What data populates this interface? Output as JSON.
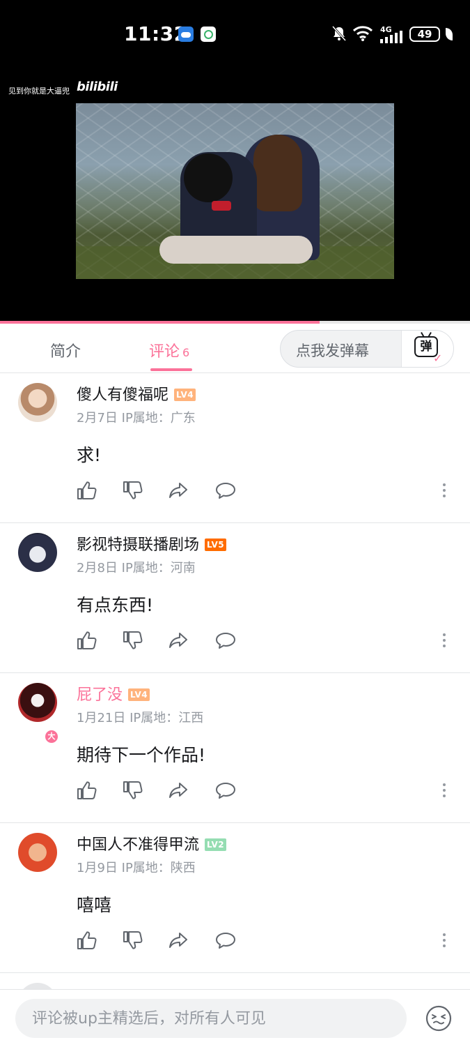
{
  "status_bar": {
    "time": "11:32",
    "network": "4G",
    "battery": "49"
  },
  "player": {
    "watermark": "见到你就是大逼兜",
    "logo": "bilibili",
    "progress": 0.68
  },
  "tabs": {
    "intro_label": "简介",
    "comments_label": "评论",
    "comments_count": "6"
  },
  "danmaku": {
    "placeholder": "点我发弹幕",
    "icon_char": "弹"
  },
  "comments": [
    {
      "username": "傻人有傻福呢",
      "level": "LV4",
      "level_color": "#ffb37c",
      "vip": false,
      "date": "2月7日",
      "ip": "IP属地：广东",
      "content": "求!"
    },
    {
      "username": "影视特摄联播剧场",
      "level": "LV5",
      "level_color": "#ff6c00",
      "vip": false,
      "date": "2月8日",
      "ip": "IP属地：河南",
      "content": "有点东西!"
    },
    {
      "username": "屁了没",
      "level": "LV4",
      "level_color": "#ffb37c",
      "vip": true,
      "badge": "大",
      "date": "1月21日",
      "ip": "IP属地：江西",
      "content": "期待下一个作品!"
    },
    {
      "username": "中国人不准得甲流",
      "level": "LV2",
      "level_color": "#95ddb2",
      "vip": false,
      "date": "1月9日",
      "ip": "IP属地：陕西",
      "content": "嘻嘻"
    }
  ],
  "icons": {
    "like": "thumbs-up-icon",
    "dislike": "thumbs-down-icon",
    "share": "share-icon",
    "reply": "reply-bubble-icon",
    "more": "more-vertical-icon",
    "emoji": "emoji-icon"
  },
  "input": {
    "placeholder": "评论被up主精选后，对所有人可见"
  },
  "colors": {
    "accent": "#fb7299",
    "text": "#18191c",
    "secondary": "#9499a0"
  }
}
